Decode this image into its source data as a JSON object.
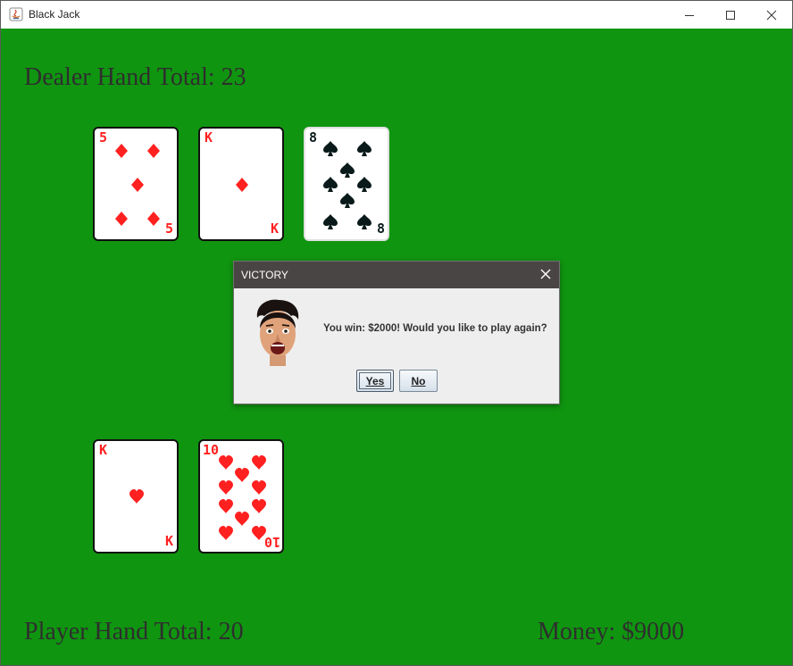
{
  "window": {
    "title": "Black Jack",
    "controls": [
      "minimize-icon",
      "maximize-icon",
      "close-icon"
    ]
  },
  "table": {
    "background_color": "#109510",
    "dealer_label": "Dealer Hand Total: 23",
    "player_label": "Player Hand Total: 20",
    "money_label": "Money: $9000"
  },
  "dealer_hand": [
    {
      "rank": "5",
      "suit": "diamonds",
      "color": "red"
    },
    {
      "rank": "K",
      "suit": "diamonds",
      "color": "red"
    },
    {
      "rank": "8",
      "suit": "spades",
      "color": "black"
    }
  ],
  "player_hand": [
    {
      "rank": "K",
      "suit": "hearts",
      "color": "red"
    },
    {
      "rank": "10",
      "suit": "hearts",
      "color": "red"
    }
  ],
  "dialog": {
    "title": "VICTORY",
    "message": "You win: $2000! Would you like to play again?",
    "yes_label": "Yes",
    "no_label": "No",
    "default_button": "Yes"
  }
}
